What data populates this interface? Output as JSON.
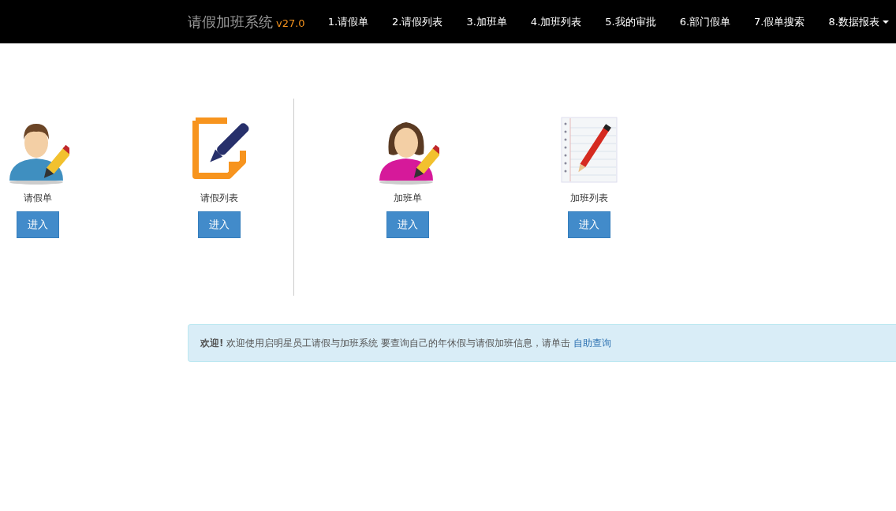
{
  "navbar": {
    "brand": "请假加班系统",
    "version": "v27.0",
    "items": [
      {
        "label": "1.请假单",
        "dropdown": false
      },
      {
        "label": "2.请假列表",
        "dropdown": false
      },
      {
        "label": "3.加班单",
        "dropdown": false
      },
      {
        "label": "4.加班列表",
        "dropdown": false
      },
      {
        "label": "5.我的审批",
        "dropdown": false
      },
      {
        "label": "6.部门假单",
        "dropdown": false
      },
      {
        "label": "7.假单搜索",
        "dropdown": false
      },
      {
        "label": "8.数据报表",
        "dropdown": true
      }
    ]
  },
  "tile_groups": [
    [
      {
        "kind": "man",
        "label": "请假单",
        "button": "进入"
      },
      {
        "kind": "document",
        "label": "请假列表",
        "button": "进入"
      }
    ],
    [
      {
        "kind": "woman",
        "label": "加班单",
        "button": "进入"
      },
      {
        "kind": "notepad",
        "label": "加班列表",
        "button": "进入"
      }
    ]
  ],
  "alert": {
    "text": "**欢迎!** 欢迎使用启明星员工请假与加班系统 要查询自己的年休假与请假加班信息，请单击 ",
    "link": "自助查询"
  }
}
